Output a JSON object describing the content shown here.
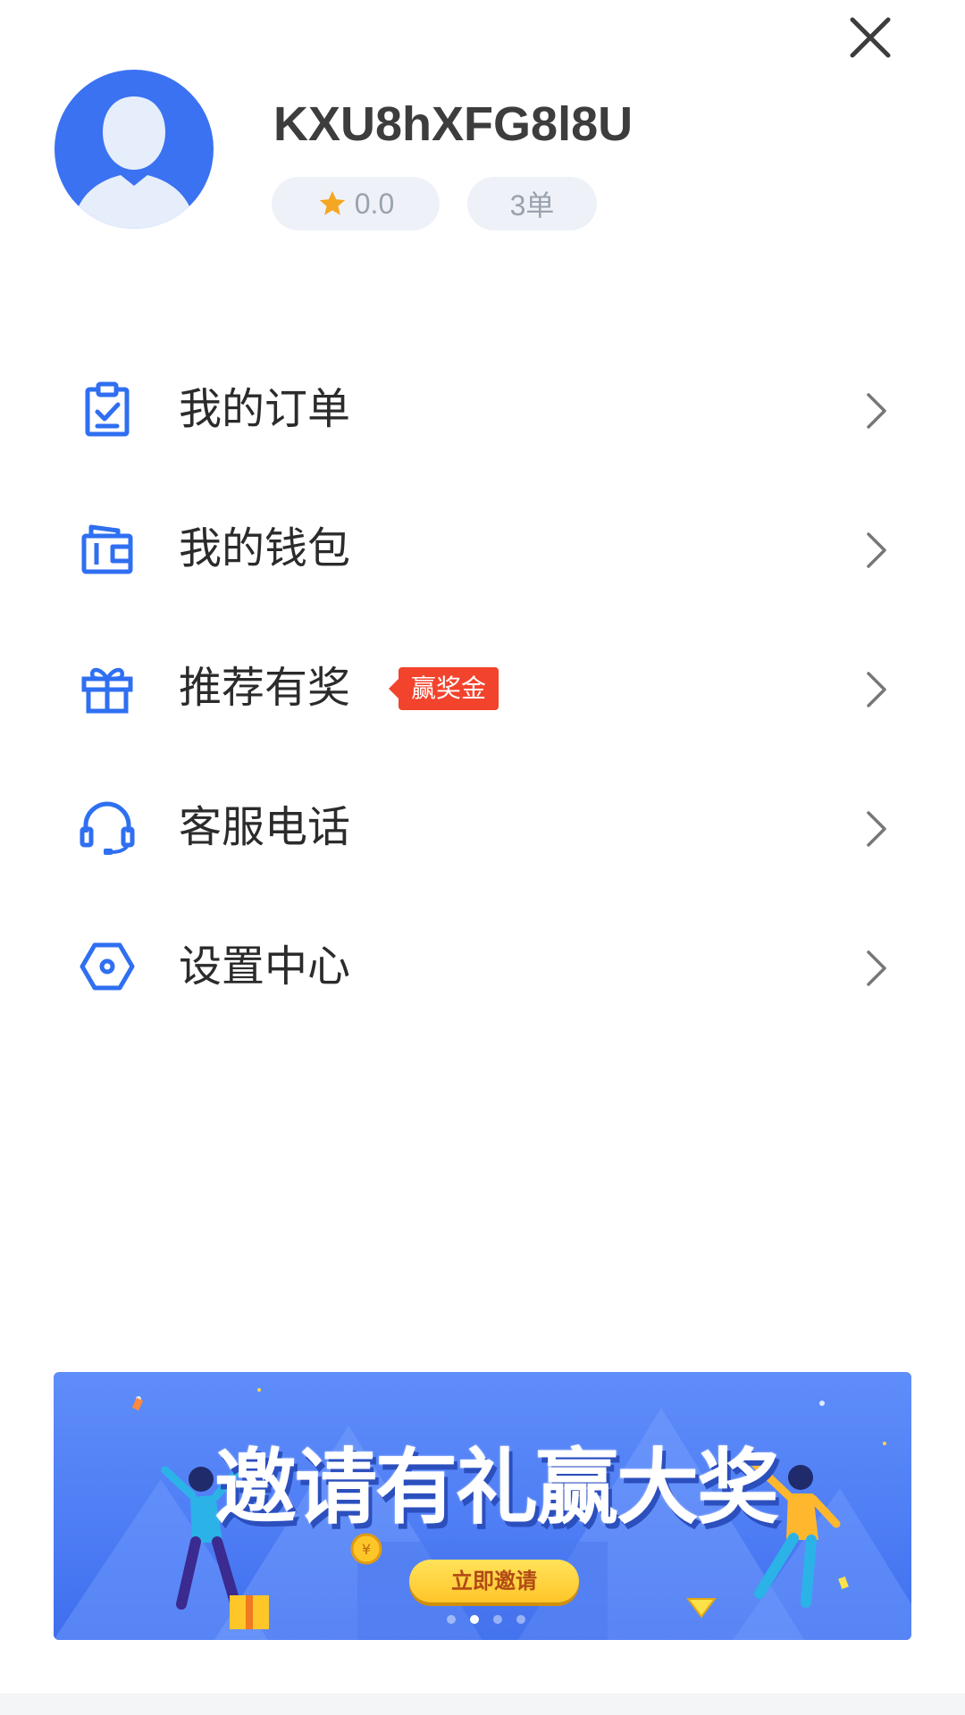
{
  "profile": {
    "username": "KXU8hXFG8l8U",
    "rating": "0.0",
    "orders": "3单"
  },
  "menu": [
    {
      "label": "我的订单",
      "icon": "order-clipboard-icon"
    },
    {
      "label": "我的钱包",
      "icon": "wallet-icon"
    },
    {
      "label": "推荐有奖",
      "icon": "gift-icon",
      "badge": "赢奖金"
    },
    {
      "label": "客服电话",
      "icon": "headset-icon"
    },
    {
      "label": "设置中心",
      "icon": "settings-hexagon-icon"
    }
  ],
  "banner": {
    "title": "邀请有礼赢大奖",
    "cta": "立即邀请",
    "slides_total": 4,
    "active_slide": 2
  },
  "colors": {
    "accent": "#2f6ff1",
    "badge": "#f2432c",
    "star": "#f5a623",
    "pill_bg": "#eef2f8",
    "text_muted": "#9aa2ad"
  }
}
